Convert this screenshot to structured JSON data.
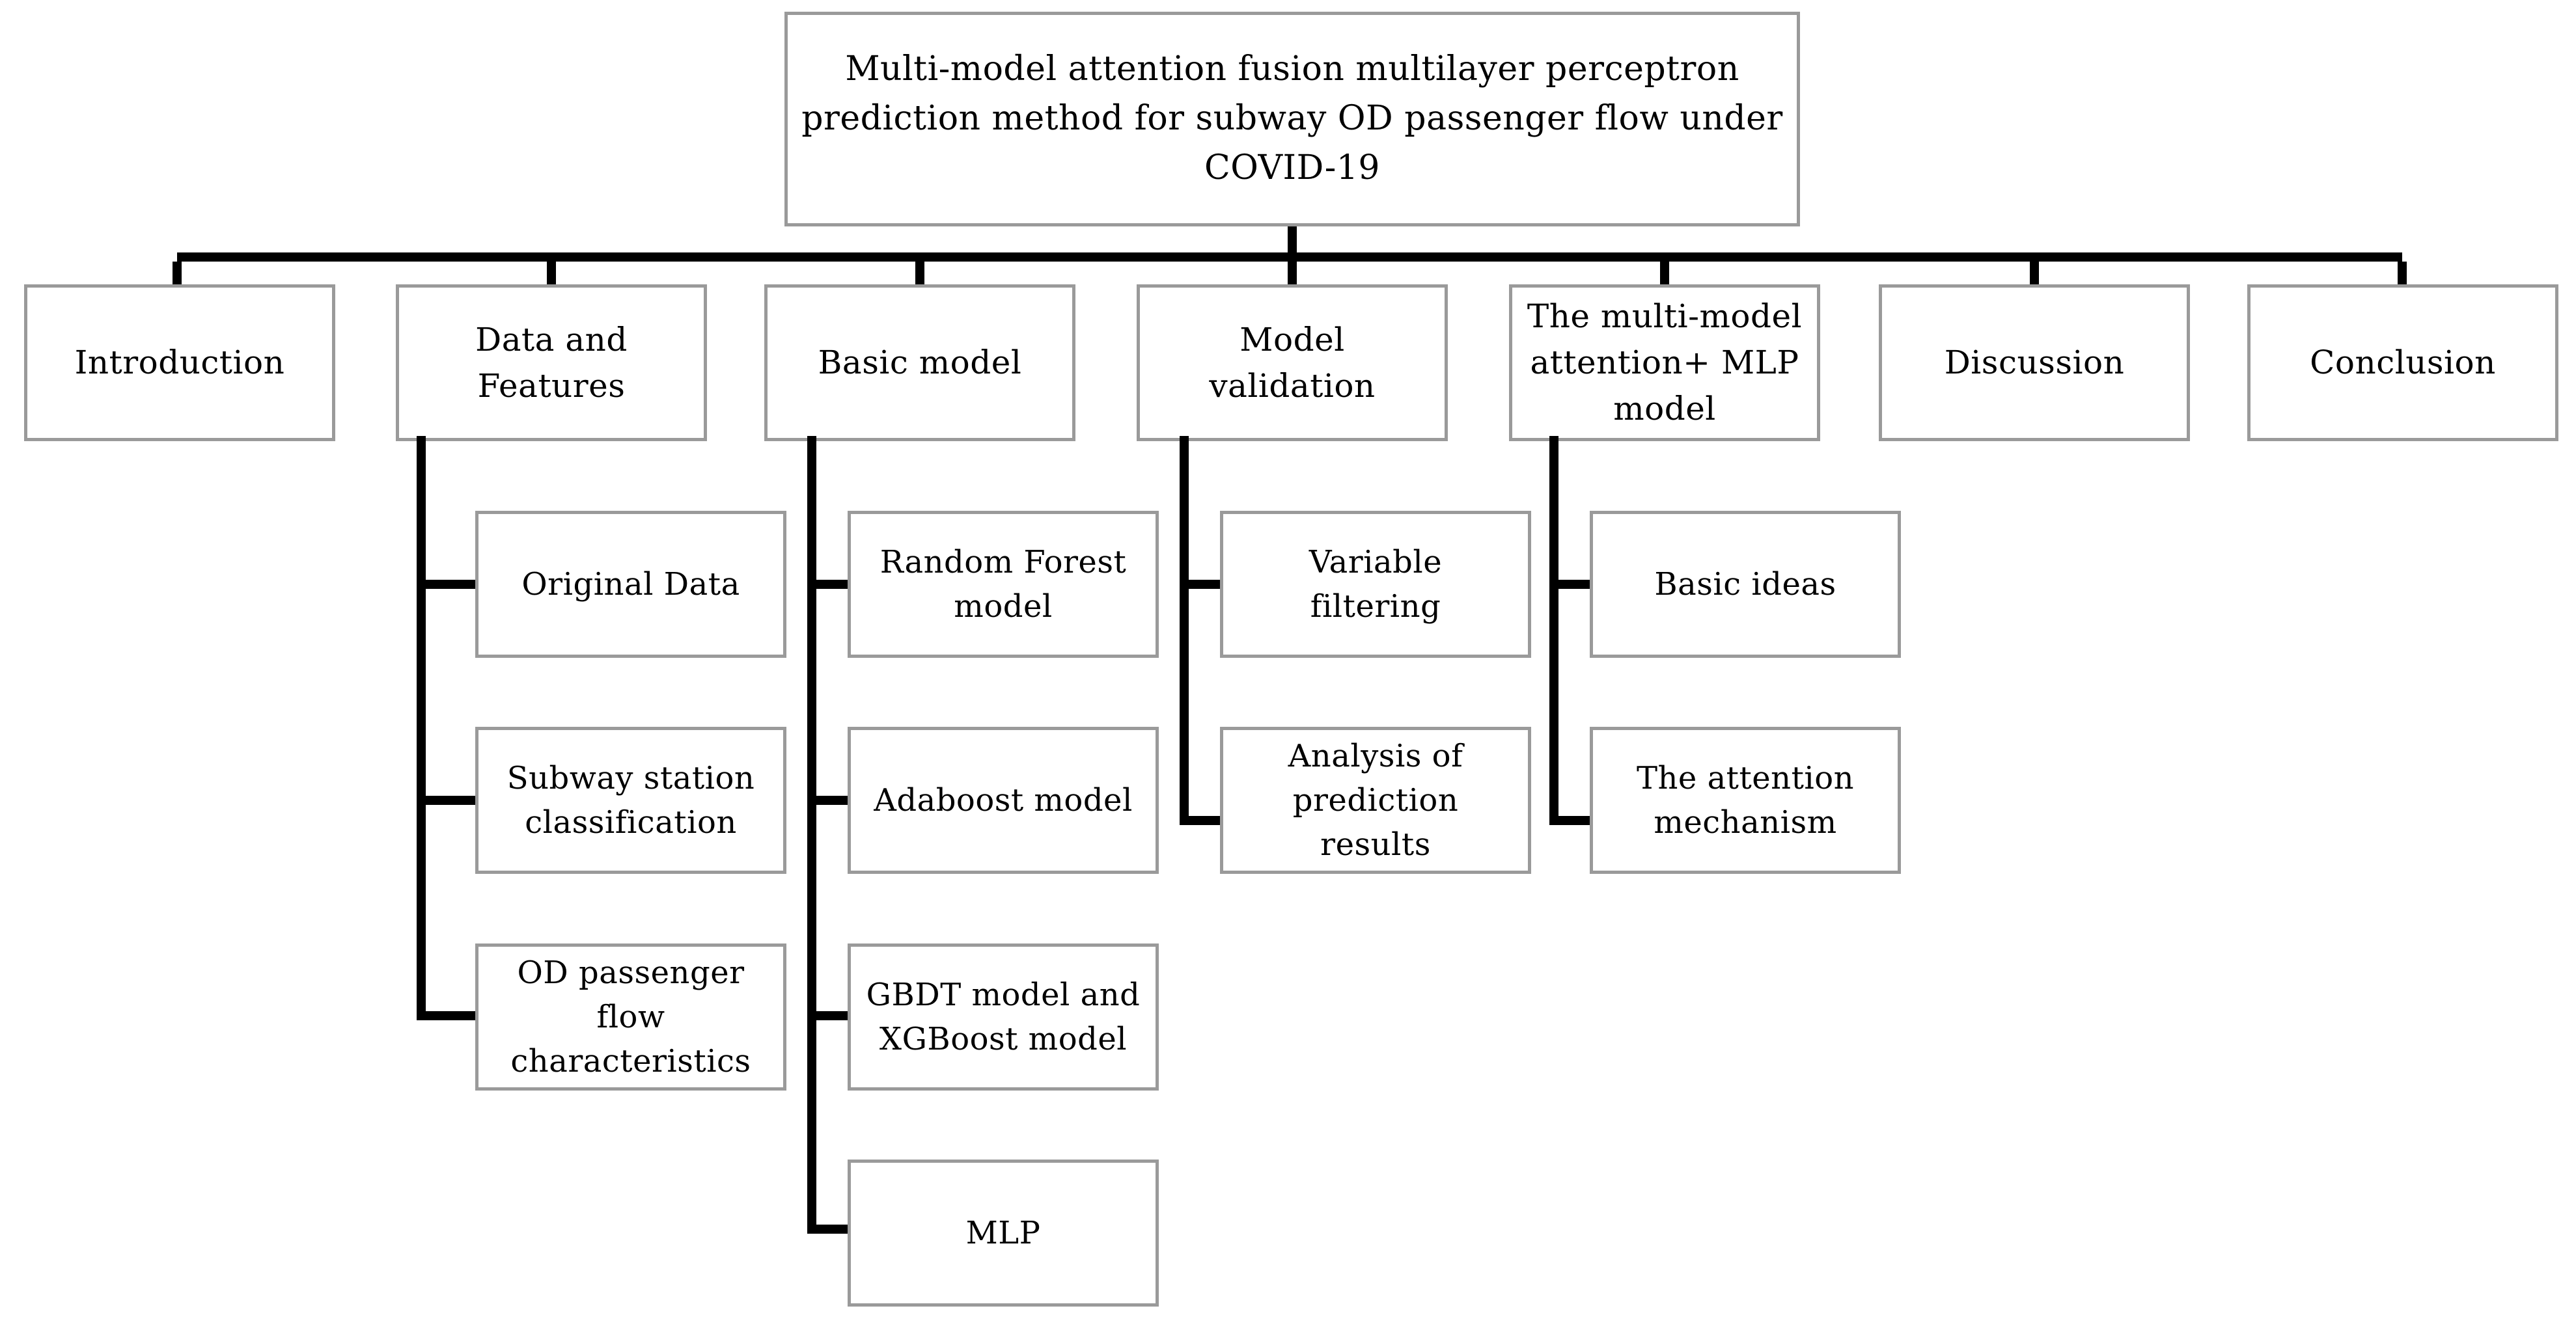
{
  "diagram": {
    "kind": "paper-structure-flowchart",
    "background_color": "#ffffff",
    "box_border_color": "#9a9a9a",
    "connector_color": "#000000",
    "text_color": "#000000"
  },
  "title_node": {
    "label": "Multi-model attention fusion multilayer perceptron prediction method for subway OD passenger flow under COVID-19"
  },
  "sections": [
    {
      "label": "Introduction"
    },
    {
      "label": "Data and\nFeatures"
    },
    {
      "label": "Basic model"
    },
    {
      "label": "Model\nvalidation"
    },
    {
      "label": "The multi-model\nattention+ MLP\nmodel"
    },
    {
      "label": "Discussion"
    },
    {
      "label": "Conclusion"
    }
  ],
  "subsections": {
    "data_and_features": [
      {
        "label": "Original Data"
      },
      {
        "label": "Subway station\nclassification"
      },
      {
        "label": "OD passenger\nflow\ncharacteristics"
      }
    ],
    "basic_model": [
      {
        "label": "Random Forest\nmodel"
      },
      {
        "label": "Adaboost model"
      },
      {
        "label": "GBDT model and\nXGBoost model"
      },
      {
        "label": "MLP"
      }
    ],
    "model_validation": [
      {
        "label": "Variable\nfiltering"
      },
      {
        "label": "Analysis of\nprediction\nresults"
      }
    ],
    "multi_model_attention_mlp": [
      {
        "label": "Basic ideas"
      },
      {
        "label": "The attention\nmechanism"
      }
    ]
  }
}
